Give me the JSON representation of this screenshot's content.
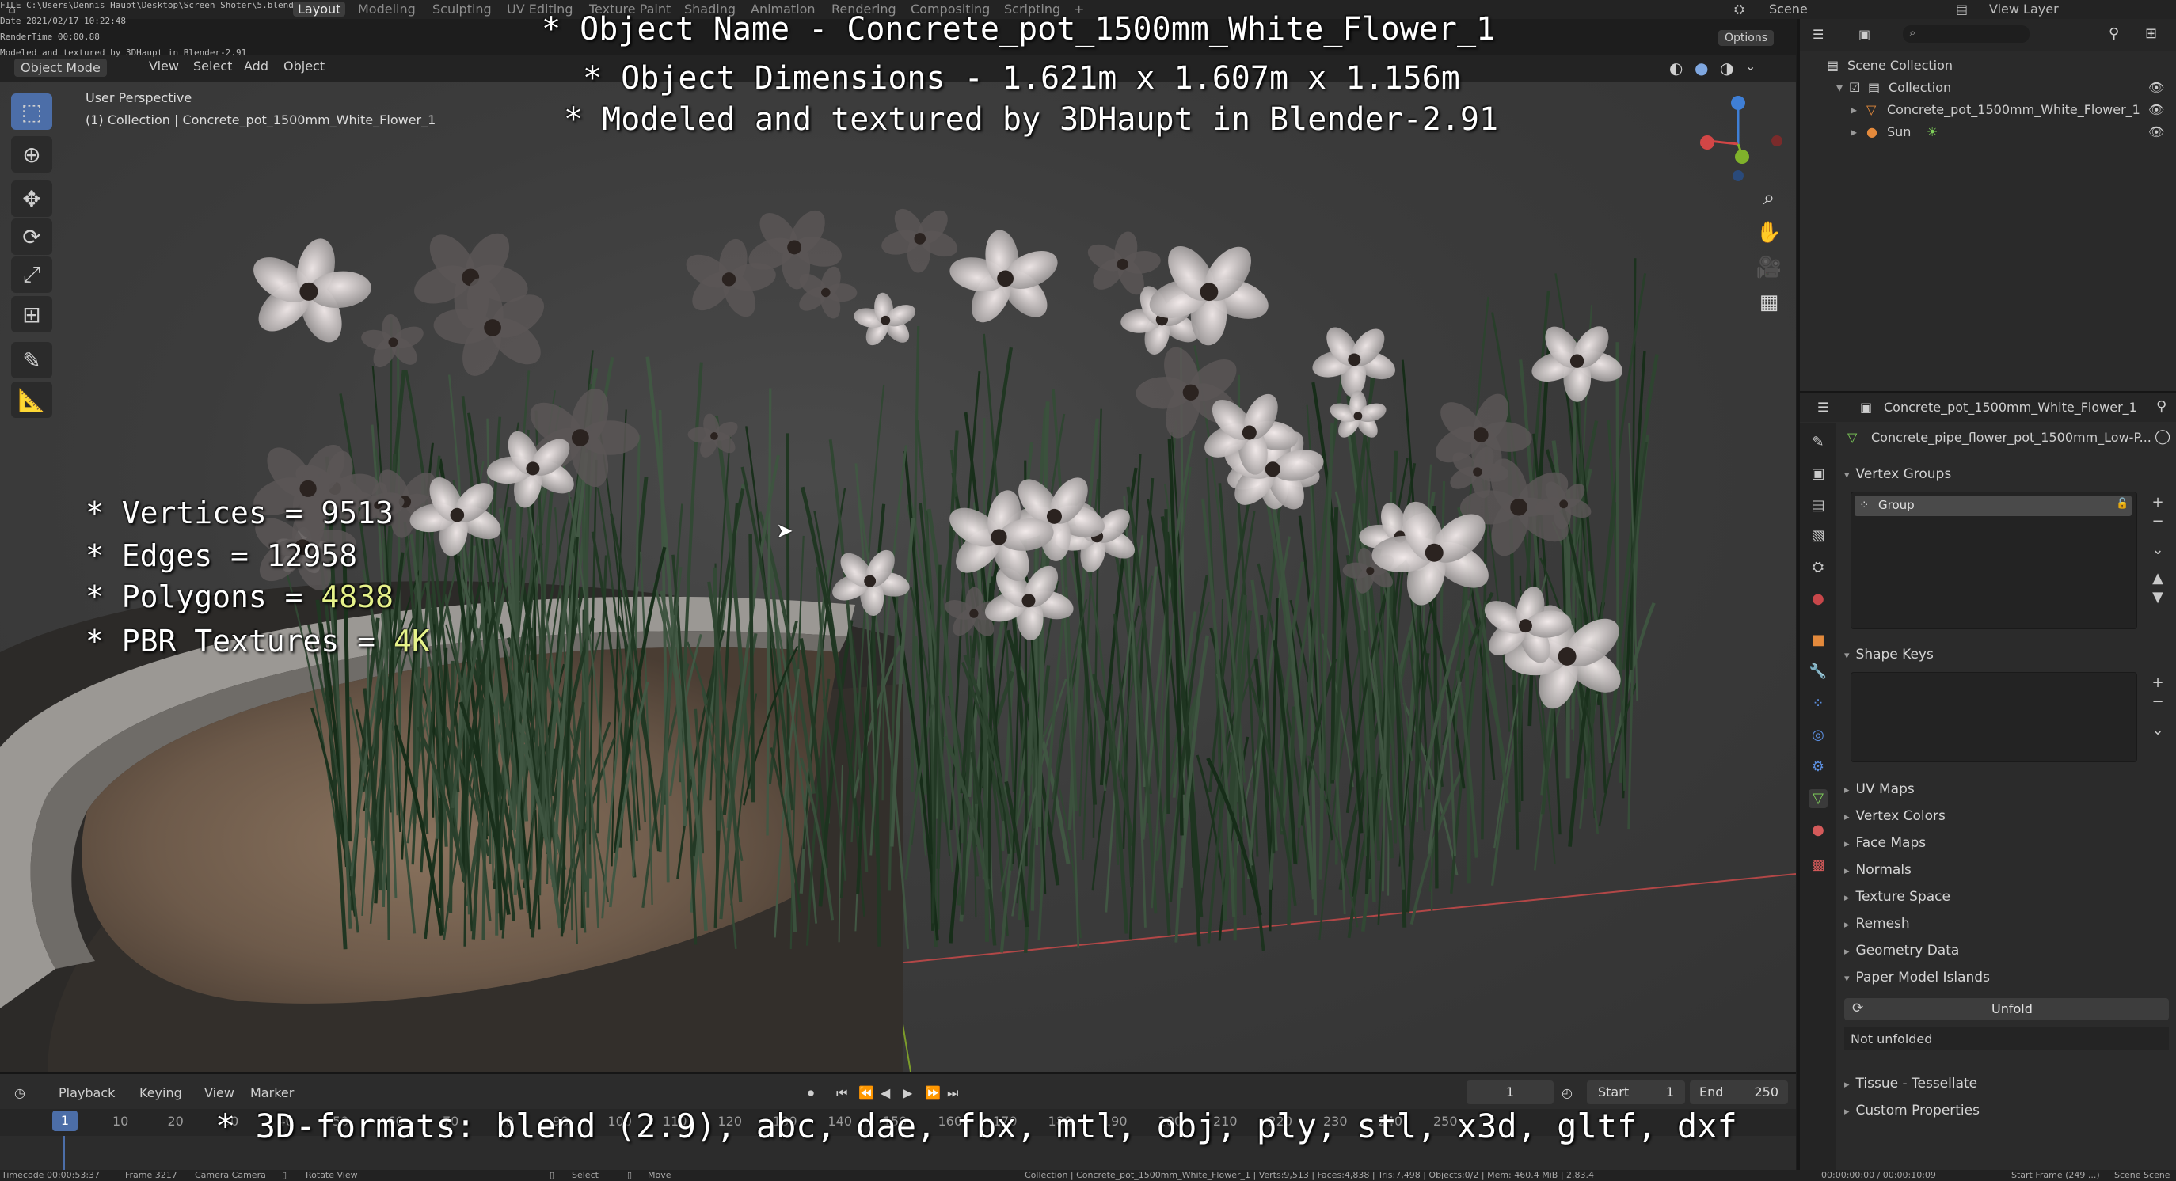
{
  "file_meta": {
    "file_line": "FILE C:\\Users\\Dennis Haupt\\Desktop\\Screen Shoter\\5.blend",
    "date_line": "Date 2021/02/17 10:22:48",
    "render_line": "RenderTime 00:00.88",
    "modeled_line": "Modeled and textured by 3DHaupt in Blender-2.91"
  },
  "workspace_tabs": [
    "Layout",
    "Modeling",
    "Sculpting",
    "UV Editing",
    "Texture Paint",
    "Shading",
    "Animation",
    "Rendering",
    "Compositing",
    "Scripting"
  ],
  "top_right": {
    "scene": "Scene",
    "view_layer": "View Layer"
  },
  "viewport_header": {
    "mode": "Object Mode",
    "menus": [
      "View",
      "Select",
      "Add",
      "Object"
    ],
    "options": "Options"
  },
  "viewport_info": {
    "perspective": "User Perspective",
    "collection": "(1) Collection | Concrete_pot_1500mm_White_Flower_1"
  },
  "overlay": {
    "title_lines": [
      "* Object Name - Concrete_pot_1500mm_White_Flower_1",
      "* Object Dimensions -  1.621m x 1.607m x 1.156m",
      "* Modeled and textured by 3DHaupt in Blender-2.91"
    ],
    "stats": [
      {
        "label": "* Vertices = ",
        "value": "9513"
      },
      {
        "label": "* Edges = ",
        "value": "12958"
      },
      {
        "label": "* Polygons = ",
        "value": "4838"
      },
      {
        "label": "* PBR Textures = ",
        "value": "4K"
      }
    ],
    "formats": "* 3D-formats: blend (2.9), abc, dae, fbx, mtl, obj, ply, stl, x3d, gltf, dxf"
  },
  "outliner": {
    "root": "Scene Collection",
    "collection": "Collection",
    "object": "Concrete_pot_1500mm_White_Flower_1",
    "light": "Sun"
  },
  "properties": {
    "object_name": "Concrete_pot_1500mm_White_Flower_1",
    "mesh_name": "Concrete_pipe_flower_pot_1500mm_Low-P...",
    "vertex_groups": "Vertex Groups",
    "group_item": "Group",
    "shape_keys": "Shape Keys",
    "collapsed_panels": [
      "UV Maps",
      "Vertex Colors",
      "Face Maps",
      "Normals",
      "Texture Space",
      "Remesh",
      "Geometry Data"
    ],
    "paper_model": "Paper Model Islands",
    "unfold_button": "Unfold",
    "not_unfolded": "Not unfolded",
    "tissue": "Tissue - Tessellate",
    "custom_props": "Custom Properties"
  },
  "timeline": {
    "menus": [
      "Playback",
      "Keying",
      "View",
      "Marker"
    ],
    "current_frame": "1",
    "start_label": "Start",
    "start_value": "1",
    "end_label": "End",
    "end_value": "250",
    "ruler": [
      "1",
      "10",
      "20",
      "30",
      "40",
      "50",
      "60",
      "70",
      "80",
      "90",
      "100",
      "110",
      "120",
      "130",
      "140",
      "150",
      "160",
      "170",
      "180",
      "190",
      "200",
      "210",
      "220",
      "230",
      "240",
      "250"
    ]
  },
  "statusbar": {
    "timecode": "Timecode 00:00:53:37",
    "frame": "Frame 3217",
    "camera": "Camera Camera",
    "rotate": "Rotate View",
    "select": "Select",
    "move": "Move",
    "stats": "Collection | Concrete_pot_1500mm_White_Flower_1 | Verts:9,513 | Faces:4,838 | Tris:7,498 | Objects:0/2 | Mem: 460.4 MiB | 2.83.4",
    "time": "00:00:00:00 / 00:00:10:09",
    "start_frame": "Start Frame (249 ...)",
    "scene": "Scene Scene"
  },
  "colors": {
    "accent_blue": "#4c6ea8",
    "stat_highlight": "#e6f28a",
    "x_axis": "#c94a4a",
    "y_axis": "#8fb33a"
  }
}
